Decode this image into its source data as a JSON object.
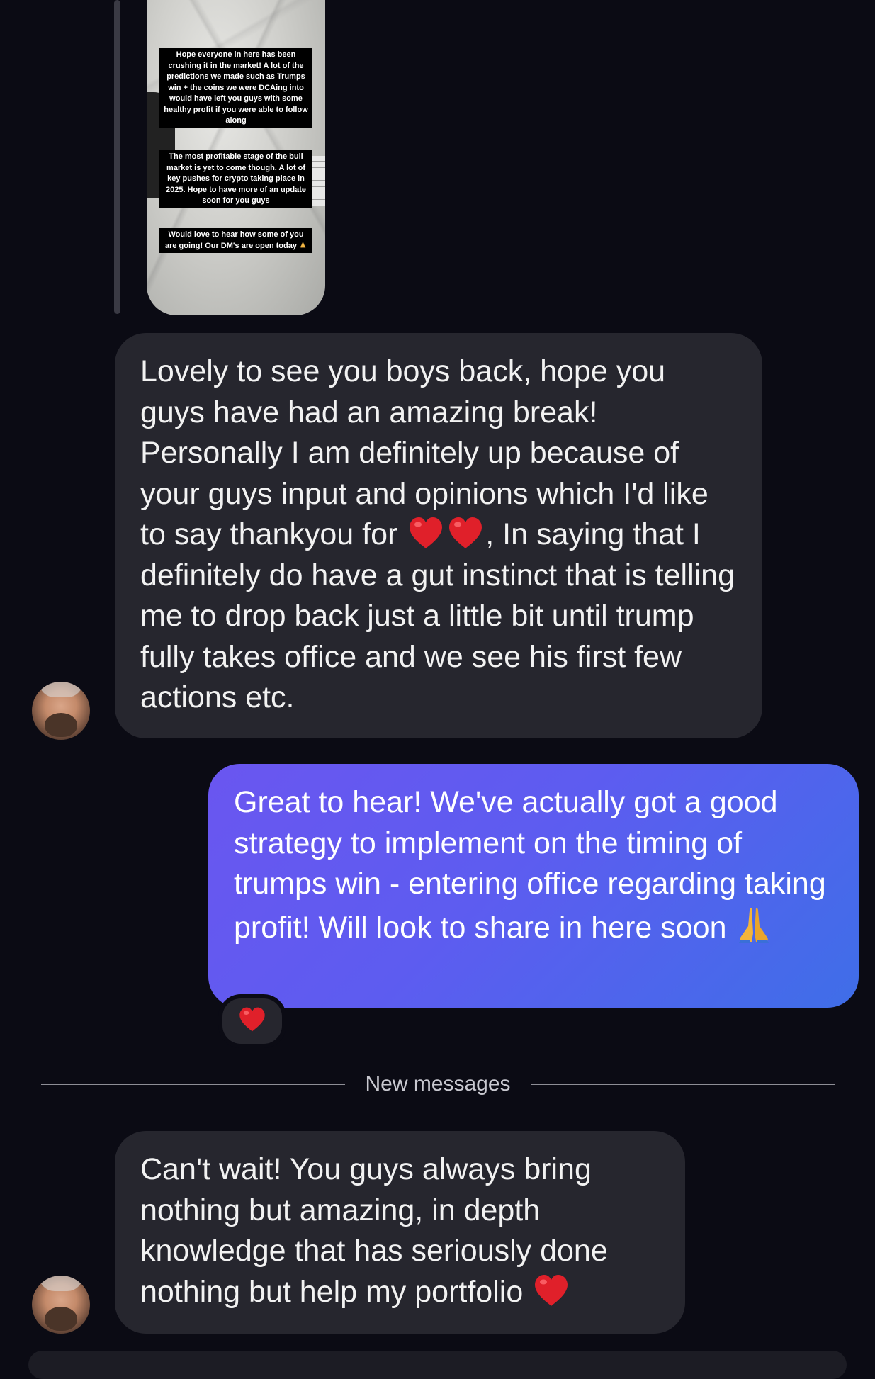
{
  "story": {
    "caption_1": "Hope everyone in here has been crushing it in the market! A lot of the predictions we made such as Trumps win + the coins we were DCAing into would have left you guys with some healthy profit if you were able to follow along",
    "caption_2": "The most profitable stage of the bull market is yet to come though. A lot of key pushes for crypto taking place in 2025. Hope to have more of an update soon for you guys",
    "caption_3": "Would love to hear how some of you are going! Our DM's are open today"
  },
  "messages": [
    {
      "direction": "incoming",
      "text": "Lovely to see you boys back, hope you guys have had an amazing break! Personally I am definitely up because of your guys input and opinions which I'd like to say thankyou for",
      "text_cont": ", In saying that I definitely do have a gut instinct that is telling me to drop back just a little bit until trump fully takes office and we see his first few actions etc.",
      "emojis": [
        "heart",
        "heart"
      ]
    },
    {
      "direction": "outgoing",
      "text": "Great to hear! We've actually got a good strategy to implement on the timing of trumps win - entering office regarding taking profit! Will look to share in here soon",
      "emojis": [
        "pray"
      ],
      "reaction": "heart"
    },
    {
      "direction": "incoming",
      "text": "Can't wait! You guys always bring nothing but amazing, in depth knowledge that has seriously done nothing but help my portfolio",
      "emojis": [
        "heart"
      ]
    }
  ],
  "divider": {
    "label": "New messages"
  },
  "colors": {
    "background": "#0b0b14",
    "incoming_bubble": "#26262e",
    "outgoing_gradient_start": "#6a56f0",
    "outgoing_gradient_end": "#3f6ee8",
    "heart": "#e0202a"
  },
  "icons": {
    "heart": "heart-emoji",
    "pray": "praying-hands-emoji"
  }
}
